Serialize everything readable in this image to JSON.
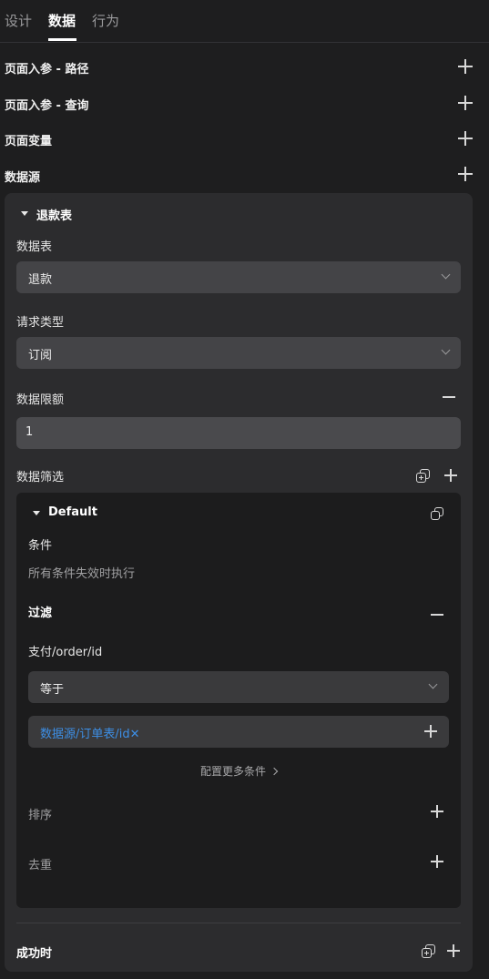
{
  "tabs": [
    {
      "label": "设计"
    },
    {
      "label": "数据",
      "active": true
    },
    {
      "label": "行为"
    }
  ],
  "sections": {
    "path_params": "页面入参 - 路径",
    "query_params": "页面入参 - 查询",
    "page_vars": "页面变量",
    "datasource": "数据源"
  },
  "datasource_card": {
    "title": "退款表",
    "table_label": "数据表",
    "table_value": "退款",
    "request_type_label": "请求类型",
    "request_type_value": "订阅",
    "limit_label": "数据限额",
    "limit_value": "1",
    "filter_label": "数据筛选",
    "filter_group": {
      "title": "Default",
      "condition_label": "条件",
      "condition_desc": "所有条件失效时执行",
      "filter_label": "过滤",
      "field_path": "支付/order/id",
      "operator": "等于",
      "value_tag": "数据源/订单表/id",
      "value_tag_remove": "✕",
      "more_conditions": "配置更多条件",
      "sort_label": "排序",
      "dedupe_label": "去重"
    },
    "on_success_label": "成功时"
  },
  "colors": {
    "background": "#1e1e1f",
    "card": "#2c2c2e",
    "inner_card": "#1c1c1d",
    "select": "#444447",
    "link_blue": "#3d8fe6"
  },
  "icons": [
    "plus-icon",
    "minus-icon",
    "chevron-down-icon",
    "caret-down-icon",
    "copy-icon",
    "add-layer-icon",
    "chevron-right-icon"
  ]
}
